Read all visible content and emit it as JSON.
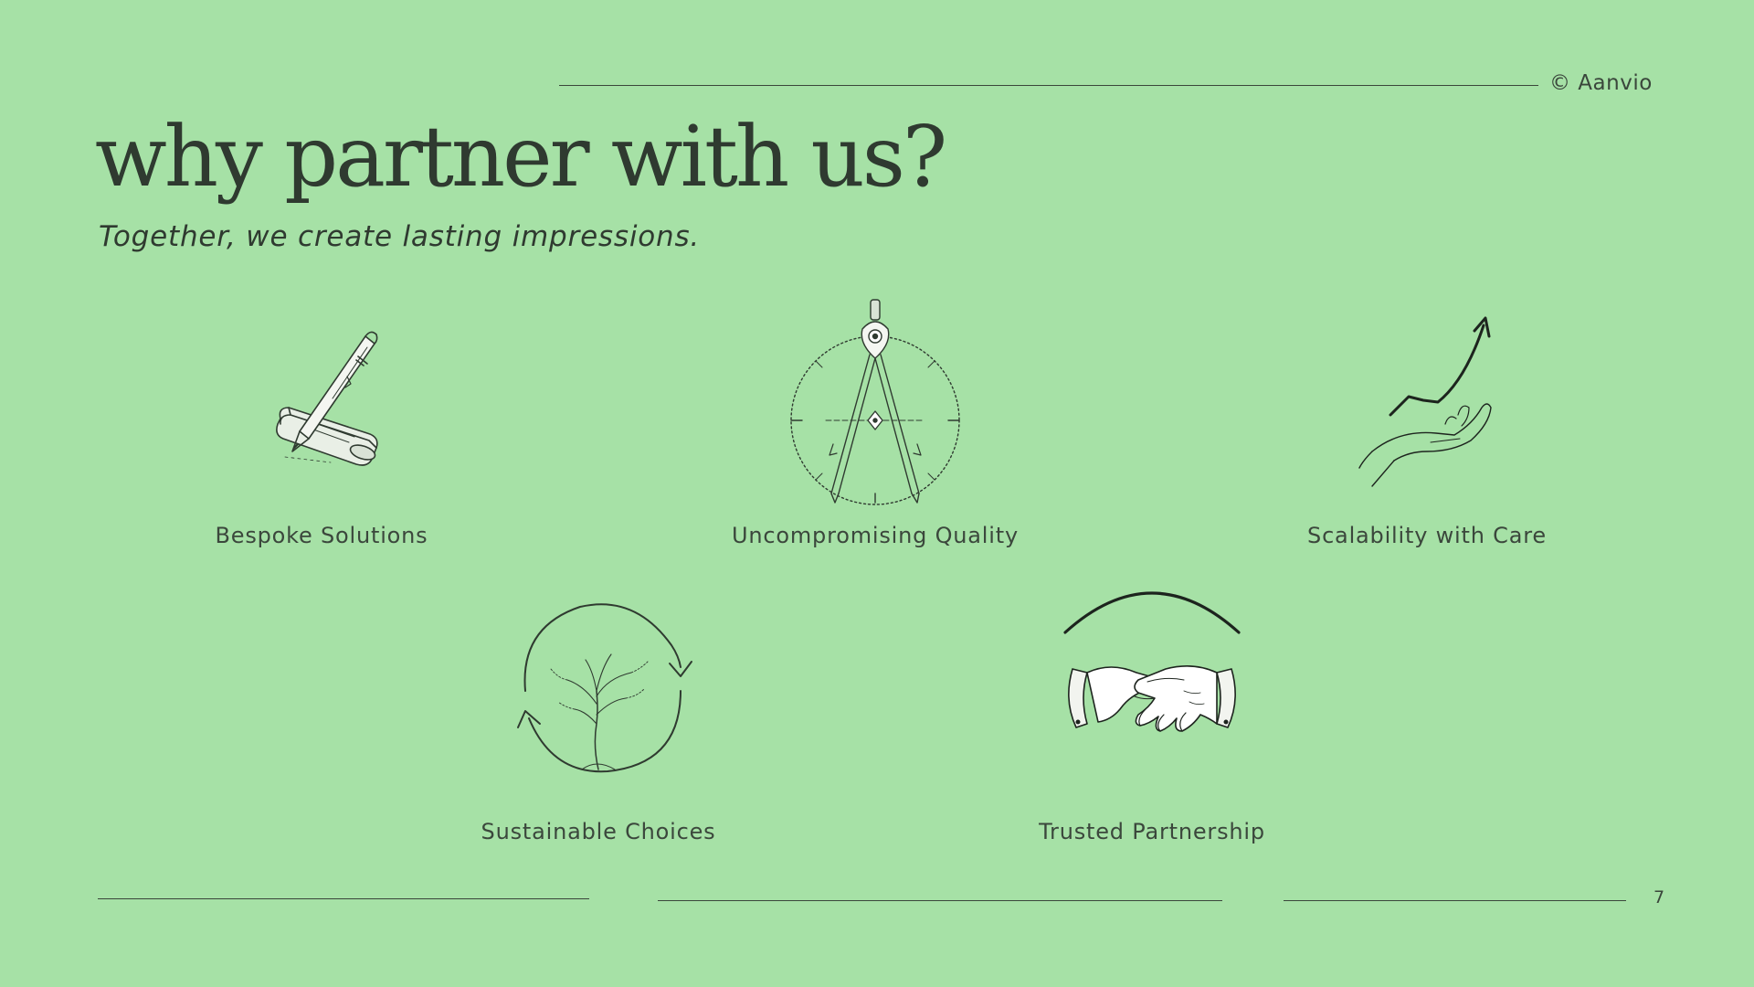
{
  "slide": {
    "background": "#a6e1a6",
    "brand": "© Aanvio",
    "title": "why partner with us?",
    "subtitle": "Together, we create lasting impressions.",
    "page_number": "7"
  },
  "features": [
    {
      "label": "Bespoke Solutions",
      "icon": "pen-and-eraser-icon"
    },
    {
      "label": "Uncompromising Quality",
      "icon": "drafting-compass-icon"
    },
    {
      "label": "Scalability with Care",
      "icon": "hand-with-rising-arrow-icon"
    },
    {
      "label": "Sustainable Choices",
      "icon": "tree-in-cycle-icon"
    },
    {
      "label": "Trusted Partnership",
      "icon": "handshake-icon"
    }
  ]
}
